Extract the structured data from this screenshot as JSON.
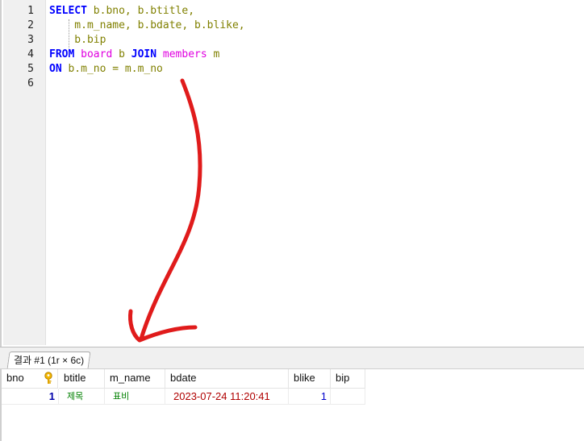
{
  "editor": {
    "line_numbers": [
      "1",
      "2",
      "3",
      "4",
      "5",
      "6"
    ],
    "lines": [
      [
        {
          "t": "SELECT",
          "c": "kw"
        },
        {
          "t": " b.bno, b.btitle,",
          "c": "id"
        }
      ],
      [
        {
          "t": "    m.m_name, b.bdate, b.blike,",
          "c": "id"
        }
      ],
      [
        {
          "t": "    b.bip",
          "c": "id"
        }
      ],
      [
        {
          "t": "FROM",
          "c": "kw"
        },
        {
          "t": " ",
          "c": "id"
        },
        {
          "t": "board",
          "c": "tbl"
        },
        {
          "t": " b ",
          "c": "id"
        },
        {
          "t": "JOIN",
          "c": "kw"
        },
        {
          "t": " ",
          "c": "id"
        },
        {
          "t": "members",
          "c": "tbl"
        },
        {
          "t": " m",
          "c": "id"
        }
      ],
      [
        {
          "t": "ON",
          "c": "kw"
        },
        {
          "t": " b.m_no = m.m_no",
          "c": "id"
        }
      ],
      [
        {
          "t": "",
          "c": "id"
        }
      ]
    ]
  },
  "results": {
    "tab_label": "결과 #1 (1r × 6c)",
    "columns": [
      "bno",
      "btitle",
      "m_name",
      "bdate",
      "blike",
      "bip"
    ],
    "key_icon": "primary-key-icon",
    "rows": [
      {
        "bno": "1",
        "btitle": "제목",
        "m_name": "표비",
        "bdate": "2023-07-24 11:20:41",
        "blike": "1",
        "bip": ""
      }
    ]
  },
  "annotation": {
    "arrow_color": "#e01b1b"
  }
}
